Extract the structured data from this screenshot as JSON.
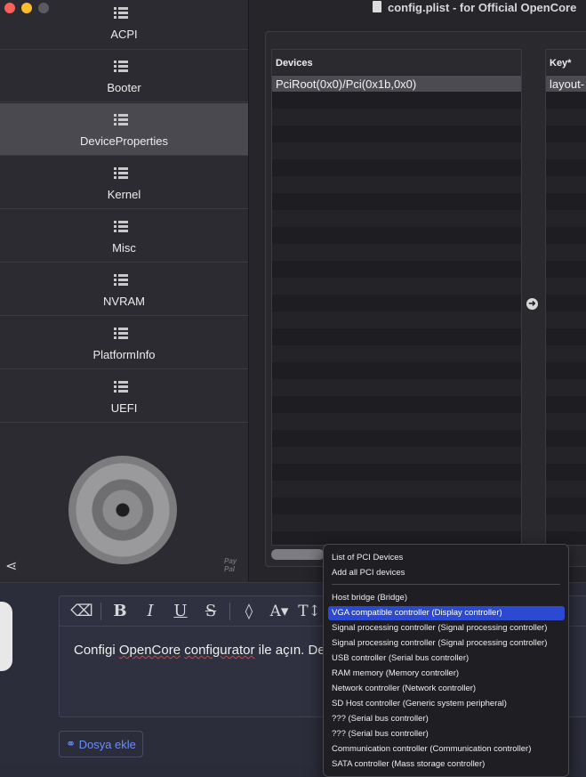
{
  "window": {
    "title": "config.plist - for Official OpenCore"
  },
  "sidebar": {
    "items": [
      {
        "label": "ACPI"
      },
      {
        "label": "Booter"
      },
      {
        "label": "DeviceProperties"
      },
      {
        "label": "Kernel"
      },
      {
        "label": "Misc"
      },
      {
        "label": "NVRAM"
      },
      {
        "label": "PlatformInfo"
      },
      {
        "label": "UEFI"
      }
    ],
    "selected": "DeviceProperties",
    "paypal_line1": "Pay",
    "paypal_line2": "Pal"
  },
  "devices_table": {
    "header": "Devices",
    "rows": [
      "PciRoot(0x0)/Pci(0x1b,0x0)"
    ]
  },
  "key_table": {
    "header": "Key*",
    "rows": [
      "layout-"
    ]
  },
  "context_menu": {
    "items": [
      "List of PCI Devices",
      "Add all PCI devices",
      "Host bridge (Bridge)",
      "VGA compatible controller (Display controller)",
      "Signal processing controller (Signal processing controller)",
      "Signal processing controller (Signal processing controller)",
      "USB controller (Serial bus controller)",
      "RAM memory (Memory controller)",
      "Network controller (Network controller)",
      "SD Host controller (Generic system peripheral)",
      "??? (Serial bus controller)",
      "??? (Serial bus controller)",
      "Communication controller (Communication controller)",
      "SATA controller (Mass storage controller)"
    ],
    "highlighted": "VGA compatible controller (Display controller)"
  },
  "editor": {
    "text_prefix": "Configi ",
    "text_err1": "OpenCore",
    "text_mid": " ",
    "text_err2": "configurator",
    "text_suffix": " ile açın. Dev",
    "attach_label": "Dosya ekle"
  },
  "colors": {
    "highlight": "#2c4ad1",
    "attach_link": "#6b8cff",
    "close": "#fe5f57",
    "minimize": "#febc2e"
  }
}
